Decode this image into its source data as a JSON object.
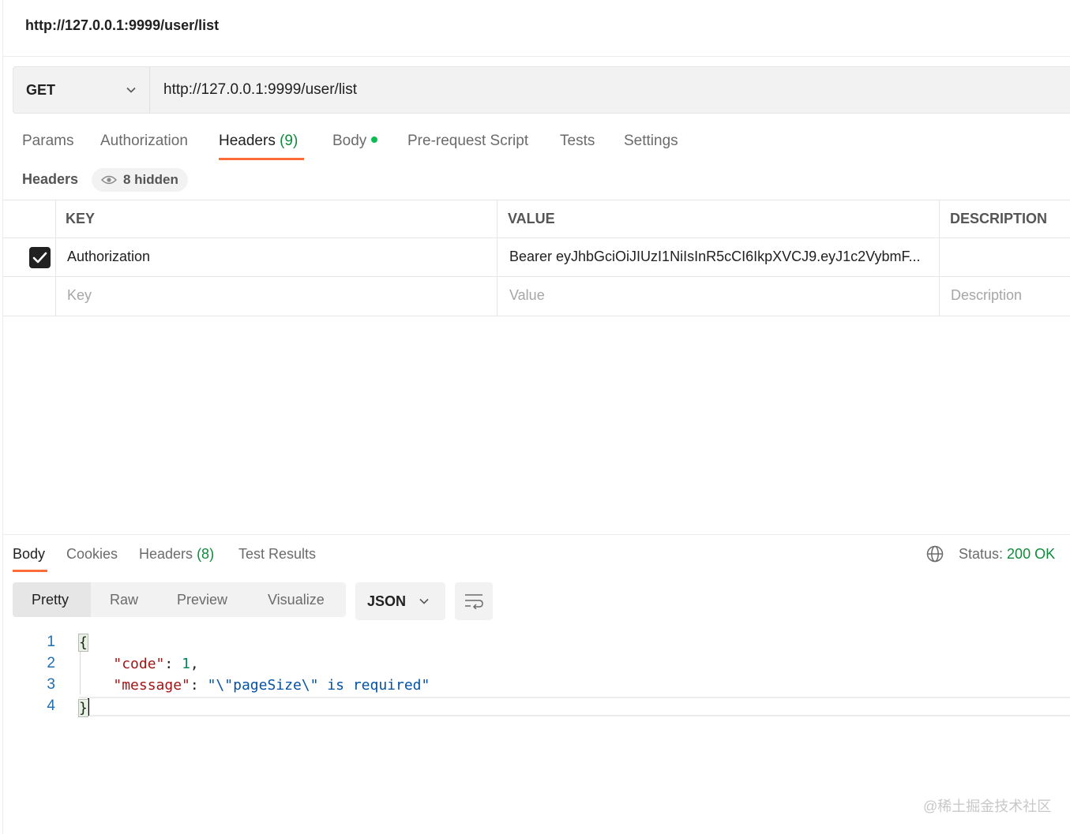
{
  "window": {
    "title": "http://127.0.0.1:9999/user/list"
  },
  "request": {
    "method": "GET",
    "url": "http://127.0.0.1:9999/user/list",
    "tabs": [
      {
        "label": "Params"
      },
      {
        "label": "Authorization"
      },
      {
        "label": "Headers",
        "count": "(9)",
        "active": true
      },
      {
        "label": "Body",
        "has_dot": true
      },
      {
        "label": "Pre-request Script"
      },
      {
        "label": "Tests"
      },
      {
        "label": "Settings"
      }
    ],
    "headers_section": {
      "label": "Headers",
      "hidden_badge": "8 hidden"
    },
    "headers_table": {
      "columns": [
        "KEY",
        "VALUE",
        "DESCRIPTION"
      ],
      "rows": [
        {
          "checked": true,
          "key": "Authorization",
          "value": "Bearer eyJhbGciOiJIUzI1NiIsInR5cCI6IkpXVCJ9.eyJ1c2VybmF...",
          "description": ""
        }
      ],
      "placeholders": {
        "key": "Key",
        "value": "Value",
        "description": "Description"
      }
    }
  },
  "response": {
    "tabs": [
      {
        "label": "Body",
        "active": true
      },
      {
        "label": "Cookies"
      },
      {
        "label": "Headers",
        "count": "(8)"
      },
      {
        "label": "Test Results"
      }
    ],
    "status_label": "Status:",
    "status_value": "200 OK",
    "view_modes": [
      "Pretty",
      "Raw",
      "Preview",
      "Visualize"
    ],
    "active_view": "Pretty",
    "format": "JSON",
    "line_numbers": [
      "1",
      "2",
      "3",
      "4"
    ],
    "body": {
      "open_brace": "{",
      "close_brace": "}",
      "code_key": "\"code\"",
      "code_value": "1",
      "message_key": "\"message\"",
      "message_value": "\"\\\"pageSize\\\" is required\""
    }
  },
  "watermark": "@稀土掘金技术社区",
  "colors": {
    "accent": "#ff6c37",
    "success": "#0f8a3a",
    "dot": "#0cbb52"
  }
}
